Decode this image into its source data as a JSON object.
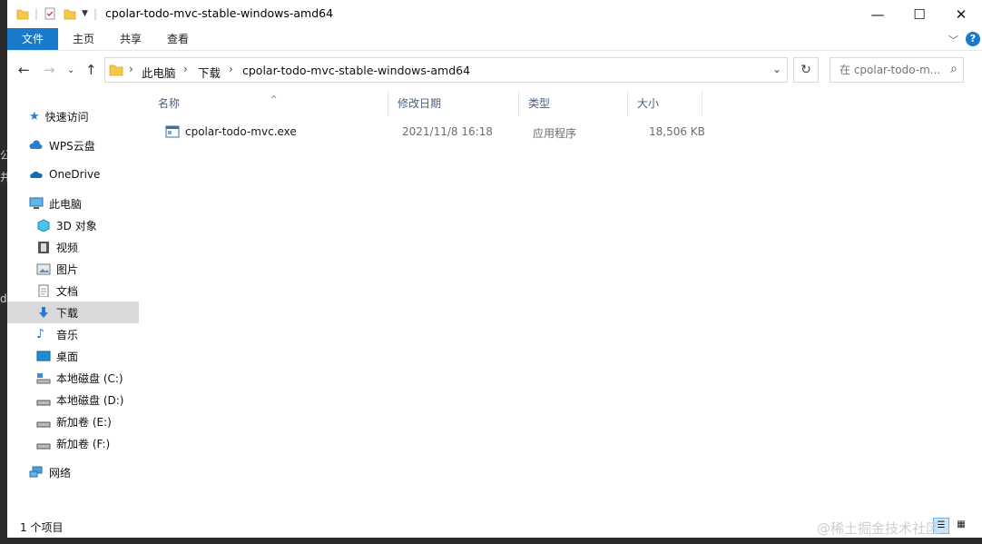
{
  "window": {
    "title": "cpolar-todo-mvc-stable-windows-amd64",
    "controls": {
      "minimize": "—",
      "maximize": "☐",
      "close": "✕"
    }
  },
  "ribbon": {
    "tabs": [
      "文件",
      "主页",
      "共享",
      "查看"
    ],
    "help": "?"
  },
  "address": {
    "crumbs": [
      "此电脑",
      "下载",
      "cpolar-todo-mvc-stable-windows-amd64"
    ],
    "search_placeholder": "在 cpolar-todo-m..."
  },
  "sidebar": {
    "items": [
      {
        "label": "快速访问",
        "icon": "star-icon"
      },
      {
        "label": "WPS云盘",
        "icon": "cloud-icon"
      },
      {
        "label": "OneDrive",
        "icon": "onedrive-icon"
      },
      {
        "label": "此电脑",
        "icon": "computer-icon"
      },
      {
        "label": "3D 对象",
        "icon": "cube-icon"
      },
      {
        "label": "视频",
        "icon": "film-icon"
      },
      {
        "label": "图片",
        "icon": "picture-icon"
      },
      {
        "label": "文档",
        "icon": "document-icon"
      },
      {
        "label": "下载",
        "icon": "download-icon"
      },
      {
        "label": "音乐",
        "icon": "music-icon"
      },
      {
        "label": "桌面",
        "icon": "desktop-icon"
      },
      {
        "label": "本地磁盘 (C:)",
        "icon": "drive-icon"
      },
      {
        "label": "本地磁盘 (D:)",
        "icon": "drive-icon"
      },
      {
        "label": "新加卷 (E:)",
        "icon": "drive-icon"
      },
      {
        "label": "新加卷 (F:)",
        "icon": "drive-icon"
      },
      {
        "label": "网络",
        "icon": "network-icon"
      }
    ]
  },
  "columns": [
    "名称",
    "修改日期",
    "类型",
    "大小"
  ],
  "files": [
    {
      "name": "cpolar-todo-mvc.exe",
      "modified": "2021/11/8 16:18",
      "type": "应用程序",
      "size": "18,506 KB"
    }
  ],
  "status": {
    "count": "1 个项目"
  },
  "watermark": "@稀土掘金技术社区",
  "colors": {
    "accent": "#1979ca",
    "selected": "#d9d9d9",
    "header_text": "#4c607a"
  }
}
